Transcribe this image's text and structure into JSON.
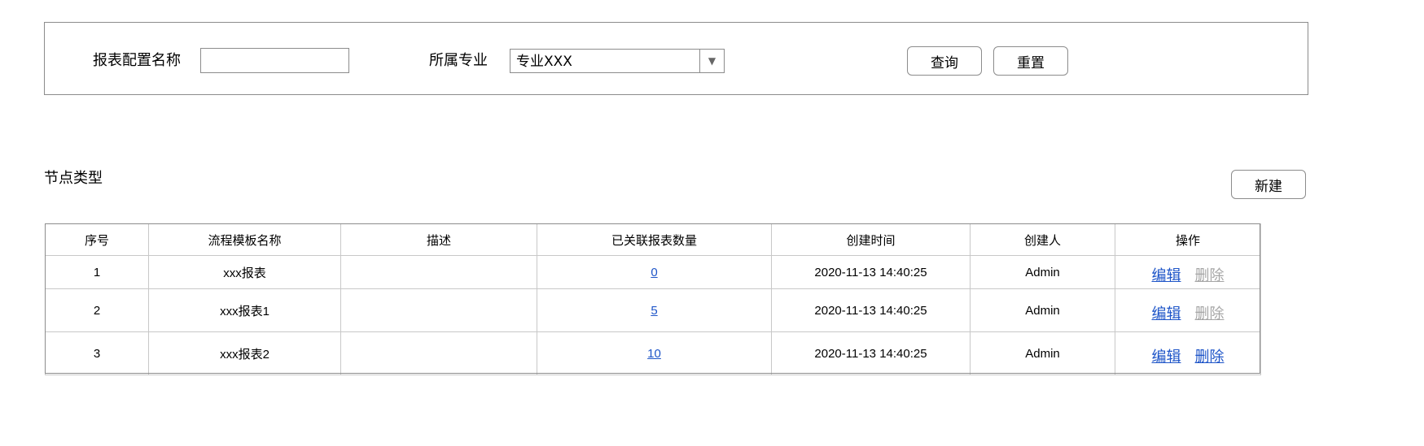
{
  "filter": {
    "report_name_label": "报表配置名称",
    "report_name_value": "",
    "major_label": "所属专业",
    "major_selected": "专业XXX",
    "query_label": "查询",
    "reset_label": "重置"
  },
  "section": {
    "title": "节点类型",
    "new_label": "新建"
  },
  "table": {
    "headers": [
      "序号",
      "流程模板名称",
      "描述",
      "已关联报表数量",
      "创建时间",
      "创建人",
      "操作"
    ],
    "rows": [
      {
        "index": "1",
        "name": "xxx报表",
        "desc": "",
        "count": "0",
        "created": "2020-11-13 14:40:25",
        "creator": "Admin",
        "edit": "编辑",
        "delete": "删除",
        "delete_enabled": false
      },
      {
        "index": "2",
        "name": "xxx报表1",
        "desc": "",
        "count": "5",
        "created": "2020-11-13 14:40:25",
        "creator": "Admin",
        "edit": "编辑",
        "delete": "删除",
        "delete_enabled": false
      },
      {
        "index": "3",
        "name": "xxx报表2",
        "desc": "",
        "count": "10",
        "created": "2020-11-13 14:40:25",
        "creator": "Admin",
        "edit": "编辑",
        "delete": "删除",
        "delete_enabled": true
      }
    ]
  },
  "colors": {
    "link": "#1e55c8",
    "disabled": "#a6a6a6",
    "border": "#8c8c8c"
  }
}
